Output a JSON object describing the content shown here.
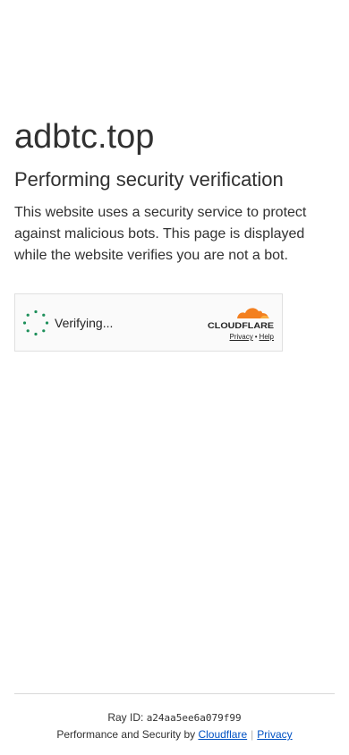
{
  "page": {
    "domain": "adbtc.top",
    "heading": "Performing security verification",
    "description": "This website uses a security service to protect against malicious bots. This page is displayed while the website verifies you are not a bot."
  },
  "widget": {
    "status_text": "Verifying...",
    "logo_text": "CLOUDFLARE",
    "privacy_label": "Privacy",
    "separator": "•",
    "help_label": "Help",
    "spinner_color": "#1d8f5a",
    "logo_orange": "#f38020",
    "logo_light": "#faae40"
  },
  "footer": {
    "ray_label": "Ray ID: ",
    "ray_id": "a24aa5ee6a079f99",
    "perf_label": "Performance and Security by ",
    "cloudflare_link": "Cloudflare",
    "divider": "|",
    "privacy_link": "Privacy",
    "link_color": "#0051c3"
  }
}
